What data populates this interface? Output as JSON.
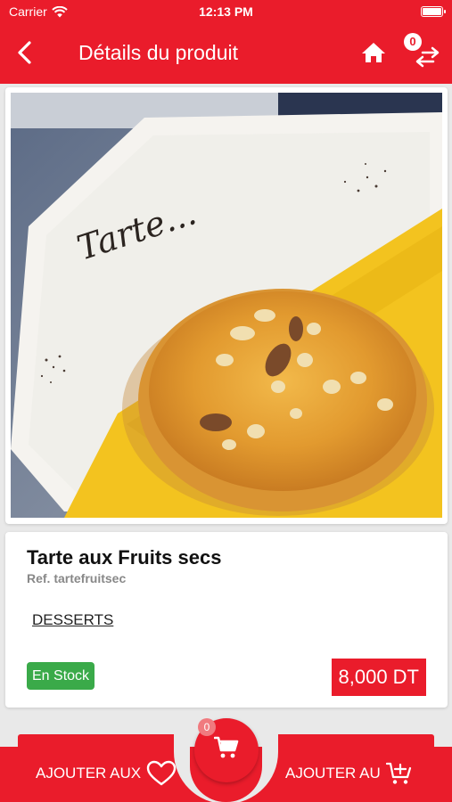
{
  "status_bar": {
    "carrier": "Carrier",
    "time": "12:13 PM"
  },
  "navbar": {
    "title": "Détails du produit",
    "compare_count": "0"
  },
  "image": {
    "plate_text": "Tarte...",
    "colors": {
      "plate": "#f4f2ee",
      "napkin": "#f2c41d",
      "tart": "#e0a23b",
      "table": "#8b96a8"
    }
  },
  "product": {
    "name": "Tarte aux Fruits secs",
    "ref": "Ref. tartefruitsec",
    "category": "DESSERTS",
    "stock": "En Stock",
    "price": "8,000 DT"
  },
  "bottom_bar": {
    "wishlist_label": "AJOUTER AUX",
    "cart_label": "AJOUTER AU",
    "cart_count": "0"
  },
  "colors": {
    "accent": "#ea1c2b",
    "stock": "#3aaa49",
    "background": "#e9e9e9"
  }
}
